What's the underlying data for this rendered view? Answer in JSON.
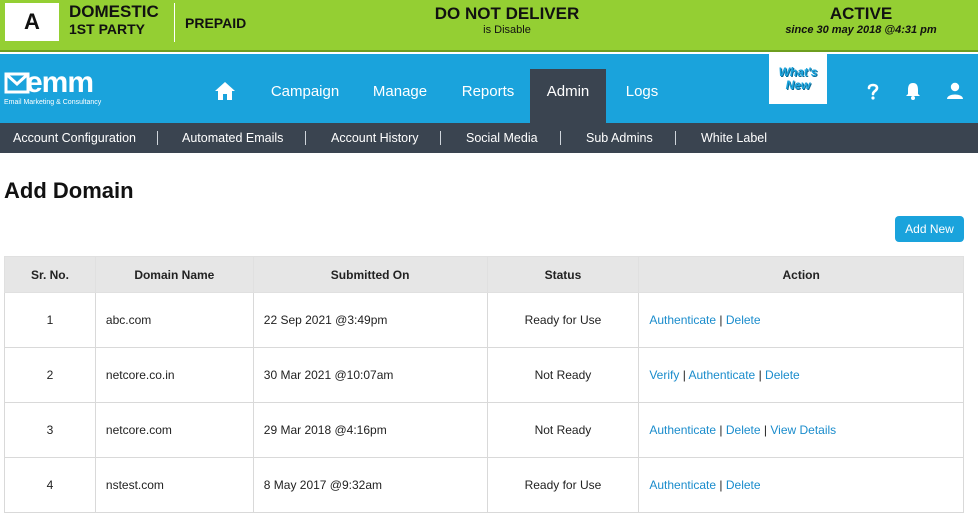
{
  "status_bar": {
    "account_letter": "A",
    "domestic": "DOMESTIC",
    "party": "1ST PARTY",
    "plan": "PREPAID",
    "deliver_title": "DO NOT DELIVER",
    "deliver_sub": "is Disable",
    "active_title": "ACTIVE",
    "active_sub": "since 30 may 2018 @4:31 pm",
    "color": "#94cf33"
  },
  "brand": {
    "logo_text": "emm",
    "tagline": "Email Marketing & Consultancy",
    "color": "#1aa3dc"
  },
  "nav": {
    "home_icon": "home-icon",
    "items": [
      {
        "label": "Campaign"
      },
      {
        "label": "Manage"
      },
      {
        "label": "Reports"
      },
      {
        "label": "Admin"
      },
      {
        "label": "Logs"
      }
    ],
    "active": "Admin",
    "whats_new_l1": "What's",
    "whats_new_l2": "New",
    "icons": [
      "help-icon",
      "bell-icon",
      "user-icon"
    ]
  },
  "submenu": {
    "items": [
      {
        "label": "Account Configuration"
      },
      {
        "label": "Automated Emails"
      },
      {
        "label": "Account History"
      },
      {
        "label": "Social Media"
      },
      {
        "label": "Sub Admins"
      },
      {
        "label": "White Label"
      }
    ]
  },
  "page": {
    "title": "Add Domain",
    "add_new": "Add New"
  },
  "table": {
    "headers": [
      "Sr. No.",
      "Domain Name",
      "Submitted On",
      "Status",
      "Action"
    ],
    "rows": [
      {
        "sr": "1",
        "domain": "abc.com",
        "submitted": "22 Sep 2021 @3:49pm",
        "status": "Ready for Use",
        "actions": [
          "Authenticate",
          "Delete"
        ]
      },
      {
        "sr": "2",
        "domain": "netcore.co.in",
        "submitted": "30 Mar 2021 @10:07am",
        "status": "Not Ready",
        "actions": [
          "Verify",
          "Authenticate",
          "Delete"
        ]
      },
      {
        "sr": "3",
        "domain": "netcore.com",
        "submitted": "29 Mar 2018 @4:16pm",
        "status": "Not Ready",
        "actions": [
          "Authenticate",
          "Delete",
          "View Details"
        ]
      },
      {
        "sr": "4",
        "domain": "nstest.com",
        "submitted": "8 May 2017 @9:32am",
        "status": "Ready for Use",
        "actions": [
          "Authenticate",
          "Delete"
        ]
      }
    ],
    "action_separator": "|"
  }
}
